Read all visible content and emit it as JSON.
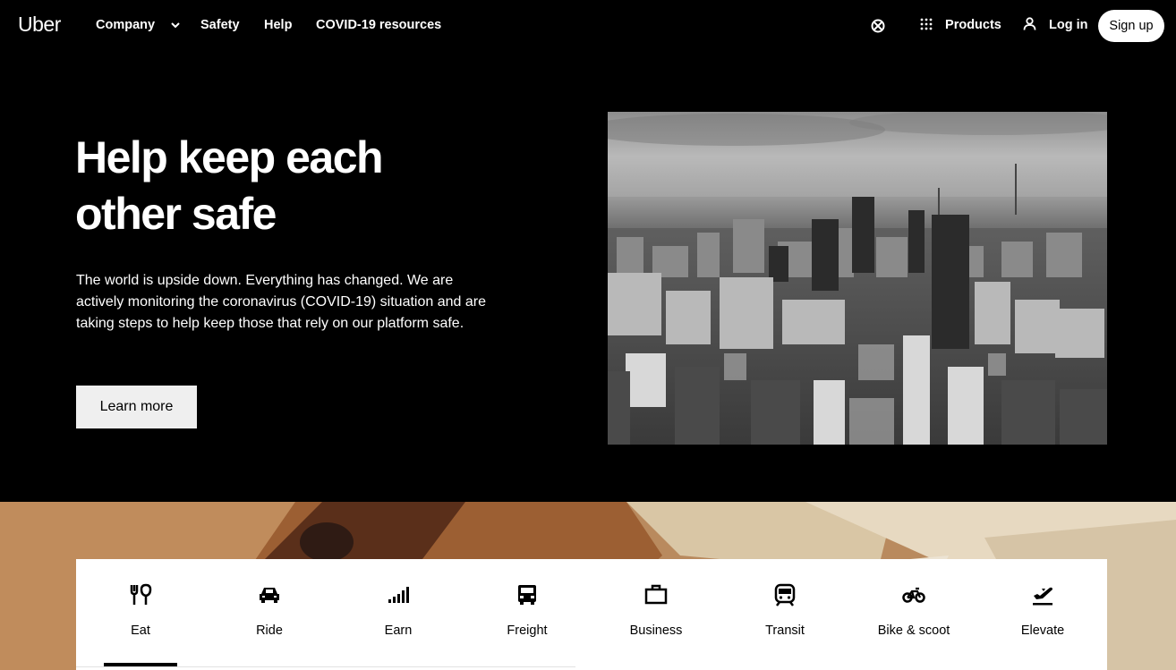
{
  "nav": {
    "logo": "Uber",
    "company": "Company",
    "safety": "Safety",
    "help": "Help",
    "covid": "COVID-19 resources",
    "products": "Products",
    "login": "Log in",
    "signup": "Sign up"
  },
  "hero": {
    "title_line1": "Help keep each",
    "title_line2": "other safe",
    "body": "The world is upside down. Everything has changed. We are actively monitoring the coronavirus (COVID-19) situation and are taking steps to help keep those that rely on our platform safe.",
    "cta": "Learn more"
  },
  "tabs": [
    {
      "label": "Eat",
      "icon": "utensils-icon",
      "selected": true
    },
    {
      "label": "Ride",
      "icon": "car-icon"
    },
    {
      "label": "Earn",
      "icon": "bars-icon"
    },
    {
      "label": "Freight",
      "icon": "truck-icon"
    },
    {
      "label": "Business",
      "icon": "briefcase-icon"
    },
    {
      "label": "Transit",
      "icon": "train-icon"
    },
    {
      "label": "Bike & scoot",
      "icon": "bike-icon"
    },
    {
      "label": "Elevate",
      "icon": "plane-icon"
    }
  ],
  "colors": {
    "background": "#000000",
    "button": "#efefef",
    "tab_panel": "#ffffff",
    "text": "#ffffff"
  }
}
